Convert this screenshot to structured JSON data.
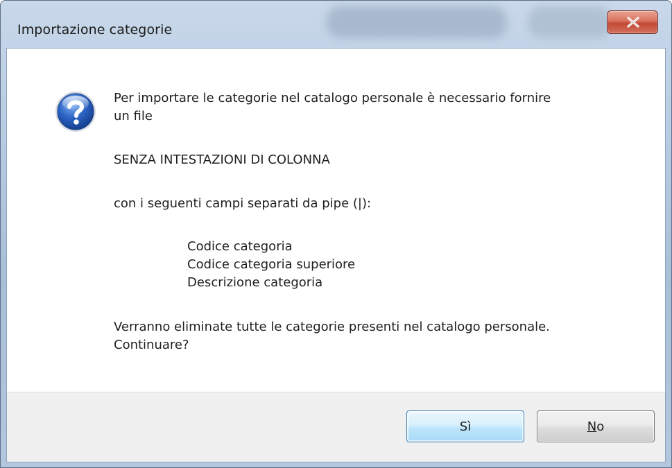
{
  "dialog": {
    "title": "Importazione categorie",
    "icon": "question-icon",
    "message": {
      "line1": "Per importare le categorie nel catalogo personale è necessario fornire",
      "line2": "un file",
      "emphasis": "SENZA INTESTAZIONI DI COLONNA",
      "fields_intro": "con i seguenti campi separati da pipe (|):",
      "fields": [
        "Codice categoria",
        "Codice categoria superiore",
        "Descrizione categoria"
      ],
      "warning_line1": "Verranno eliminate tutte le categorie presenti nel catalogo personale.",
      "warning_line2": "Continuare?"
    },
    "buttons": {
      "yes_label": "Sì",
      "no_mnemonic": "N",
      "no_rest": "o"
    },
    "close_icon": "close-icon"
  },
  "colors": {
    "close_button": "#c75a44",
    "default_button_border": "#3c7fb1",
    "footer_background": "#f0f0f0",
    "icon_blue": "#2a5fb5"
  }
}
